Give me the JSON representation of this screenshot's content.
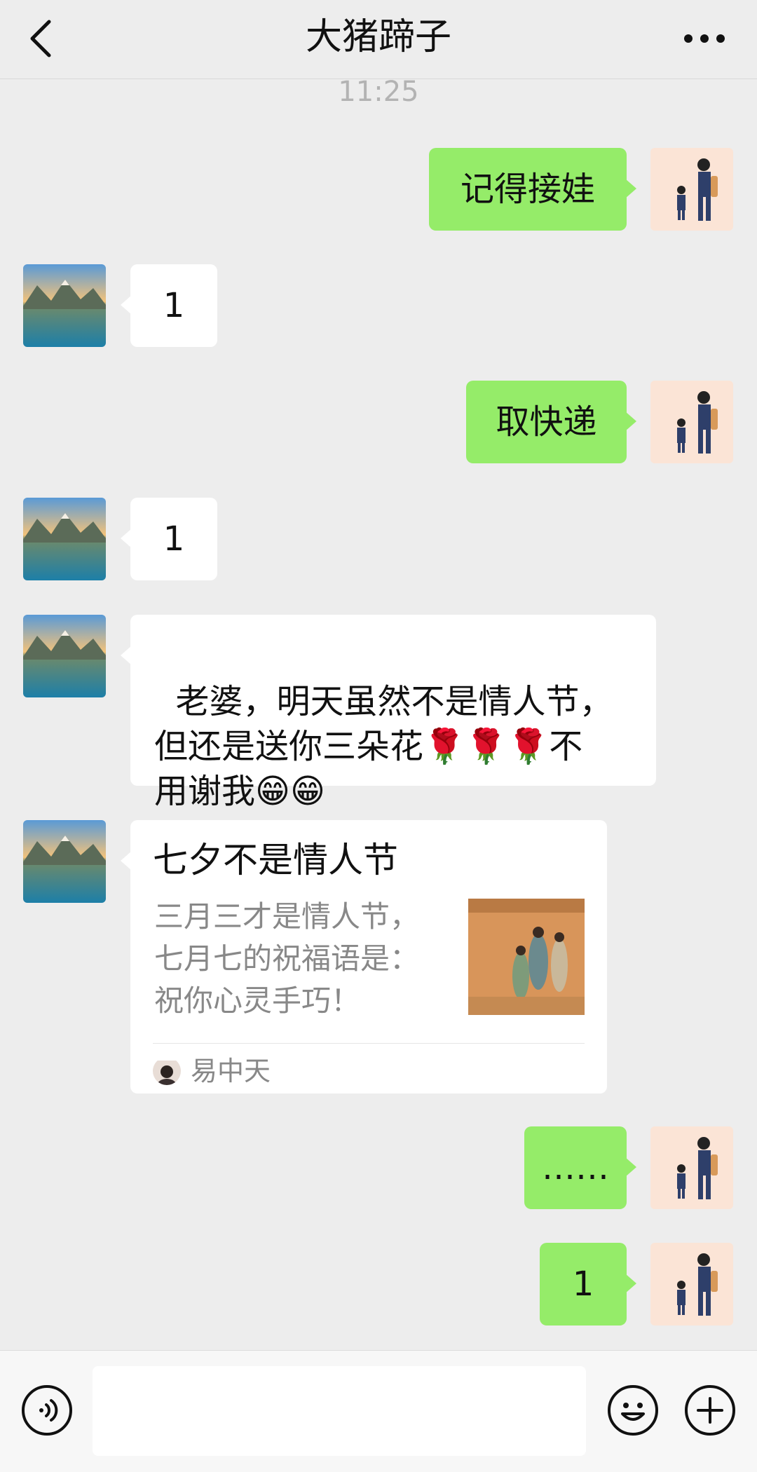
{
  "header": {
    "title": "大猪蹄子"
  },
  "chat": {
    "timestamp": "11:25",
    "messages": [
      {
        "from": "me",
        "text": "记得接娃"
      },
      {
        "from": "other",
        "text": "1"
      },
      {
        "from": "me",
        "text": "取快递"
      },
      {
        "from": "other",
        "text": "1"
      },
      {
        "from": "other",
        "text": "老婆，明天虽然不是情人节，\n但还是送你三朵花🌹🌹🌹不\n用谢我😁😁"
      },
      {
        "from": "other",
        "type": "card",
        "title": "七夕不是情人节",
        "description": "三月三才是情人节，\n七月七的祝福语是：\n祝你心灵手巧！",
        "source": "易中天"
      },
      {
        "from": "me",
        "text": "……"
      },
      {
        "from": "me",
        "text": "1"
      }
    ]
  },
  "input": {
    "placeholder": ""
  },
  "icons": {
    "back": "chevron-left-icon",
    "more": "more-dots-icon",
    "voice": "voice-icon",
    "emoji": "emoji-icon",
    "plus": "plus-icon"
  },
  "colors": {
    "my_bubble": "#95ec69",
    "their_bubble": "#ffffff",
    "background": "#ededed"
  }
}
